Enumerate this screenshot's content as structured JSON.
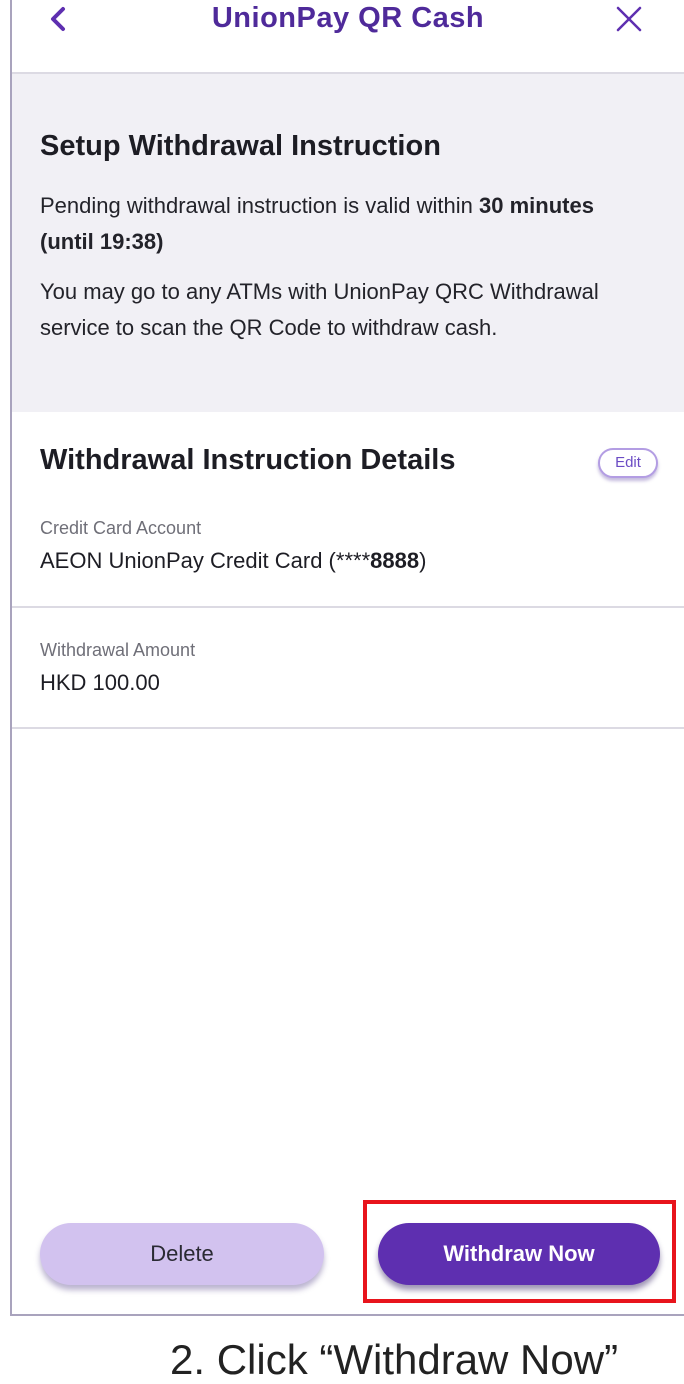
{
  "header": {
    "title": "UnionPay QR Cash",
    "back_icon": "chevron-left-icon",
    "close_icon": "close-icon"
  },
  "info": {
    "title": "Setup Withdrawal Instruction",
    "validity_text": "Pending withdrawal instruction is valid within ",
    "validity_bold": "30 minutes (until 19:38)",
    "atm_text": "You may go to any ATMs with UnionPay QRC Withdrawal service to scan the QR Code to withdraw cash."
  },
  "details": {
    "title": "Withdrawal Instruction Details",
    "edit_label": "Edit",
    "credit_card": {
      "label": "Credit Card Account",
      "value_prefix": "AEON UnionPay Credit Card (****",
      "value_bold": "8888",
      "value_suffix": ")"
    },
    "amount": {
      "label": "Withdrawal Amount",
      "value": "HKD 100.00"
    }
  },
  "actions": {
    "delete_label": "Delete",
    "withdraw_label": "Withdraw Now"
  },
  "caption": "2. Click “Withdraw Now”",
  "colors": {
    "brand_purple": "#5e2fb0",
    "title_purple": "#4f2a9a",
    "delete_bg": "#d2c2ef",
    "highlight_red": "#e8141c",
    "info_bg": "#f1f0f5"
  }
}
